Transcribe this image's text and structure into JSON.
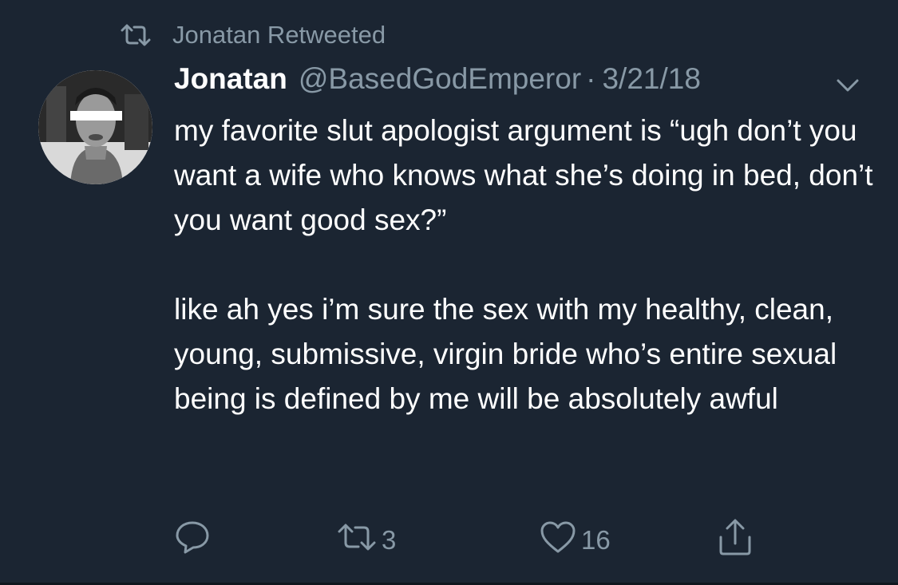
{
  "retweet_context": {
    "icon": "retweet-icon",
    "text": "Jonatan Retweeted"
  },
  "tweet": {
    "display_name": "Jonatan",
    "handle": "@BasedGodEmperor",
    "separator": "·",
    "date": "3/21/18",
    "avatar": "profile-photo",
    "paragraphs": [
      "my favorite slut apologist argument is “ugh don’t you want a wife who knows what she’s doing in bed, don’t you want good sex?”",
      "like ah yes i’m sure the sex with my healthy, clean, young, submissive, virgin bride who’s entire sexual being is defined by me will be absolutely awful"
    ]
  },
  "actions": {
    "reply": {
      "icon": "reply-icon"
    },
    "retweet": {
      "icon": "retweet-icon",
      "count": "3"
    },
    "like": {
      "icon": "heart-icon",
      "count": "16"
    },
    "share": {
      "icon": "share-icon"
    }
  },
  "colors": {
    "background": "#1b2532",
    "muted": "#8899a6",
    "text": "#ffffff"
  }
}
